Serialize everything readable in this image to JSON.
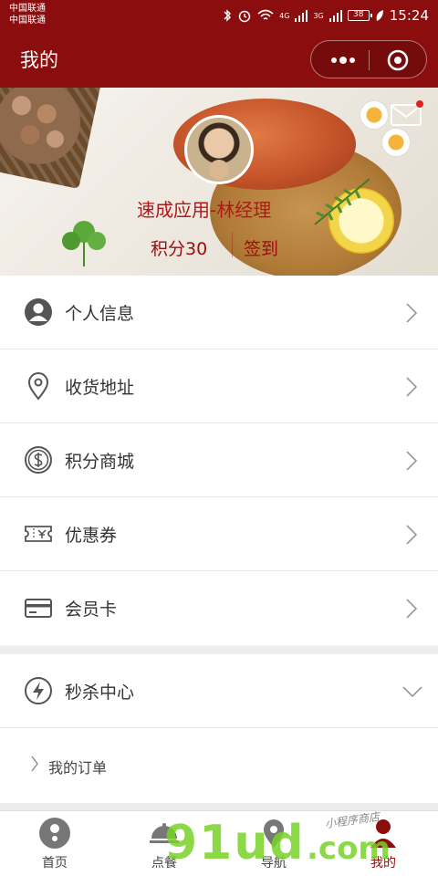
{
  "status_bar": {
    "carrier_1": "中国联通",
    "carrier_2": "中国联通",
    "battery": "38",
    "time": "15:24",
    "net_1": "4G",
    "net_2": "3G"
  },
  "nav": {
    "title": "我的"
  },
  "profile": {
    "name": "速成应用-林经理",
    "points_label": "积分30",
    "signin_label": "签到"
  },
  "menu": {
    "items": [
      {
        "label": "个人信息",
        "icon": "user-icon"
      },
      {
        "label": "收货地址",
        "icon": "location-pin-icon"
      },
      {
        "label": "积分商城",
        "icon": "dollar-coin-icon"
      },
      {
        "label": "优惠券",
        "icon": "coupon-icon"
      },
      {
        "label": "会员卡",
        "icon": "card-icon"
      }
    ]
  },
  "flash_sale": {
    "label": "秒杀中心",
    "icon": "lightning-icon",
    "sub_label": "我的订单"
  },
  "tabbar": {
    "tabs": [
      {
        "label": "首页",
        "icon": "home-icon"
      },
      {
        "label": "点餐",
        "icon": "dish-icon"
      },
      {
        "label": "导航",
        "icon": "navigation-icon"
      },
      {
        "label": "我的",
        "icon": "profile-icon"
      }
    ],
    "active_index": 3
  },
  "watermark": {
    "text": "91ud",
    "suffix": ".com",
    "small": "小程序商店"
  },
  "colors": {
    "brand": "#8b0d0d",
    "accent_text": "#b01818",
    "notify_dot": "#e0201c"
  }
}
